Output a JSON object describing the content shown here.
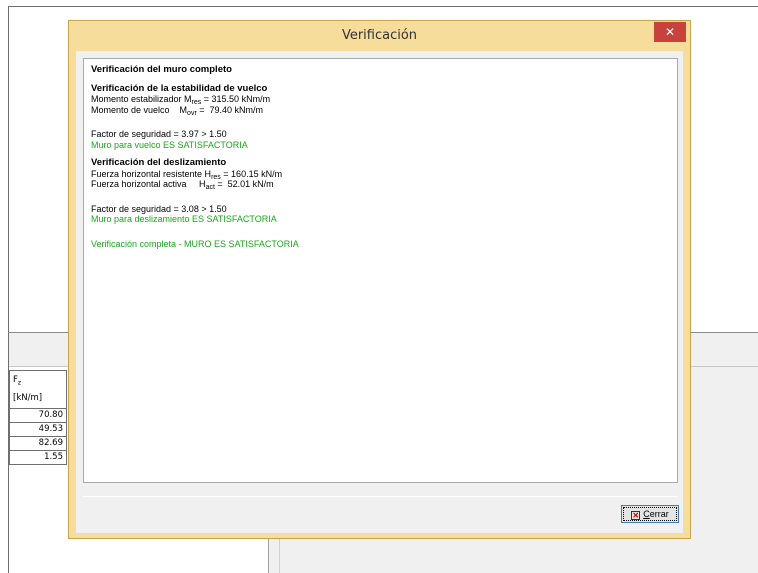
{
  "background": {
    "table": {
      "header_symbol": "F",
      "header_sub": "z",
      "header_unit": "[kN/m]",
      "rows": [
        "70.80",
        "49.53",
        "82.69",
        "1.55"
      ]
    }
  },
  "dialog": {
    "title": "Verificación",
    "close_glyph": "✕",
    "content": {
      "main_heading": "Verificación del muro completo",
      "overturning": {
        "heading": "Verificación de la estabilidad de vuelco",
        "line1_label": "Momento estabilizador M",
        "line1_sub": "res",
        "line1_value": " = 315.50 kNm/m",
        "line2_label": "Momento de vuelco    M",
        "line2_sub": "ovr",
        "line2_value": " =  79.40 kNm/m",
        "safety": "Factor de seguridad = 3.97 > 1.50",
        "result": "Muro para vuelco ES SATISFACTORIA"
      },
      "sliding": {
        "heading": "Verificación del deslizamiento",
        "line1_label": "Fuerza horizontal resistente H",
        "line1_sub": "res",
        "line1_value": " = 160.15 kN/m",
        "line2_label": "Fuerza horizontal activa     H",
        "line2_sub": "act",
        "line2_value": " =  52.01 kN/m",
        "safety": "Factor de seguridad = 3.08 > 1.50",
        "result": "Muro para deslizamiento ES SATISFACTORIA"
      },
      "final": "Verificación completa - MURO ES SATISFACTORIA"
    },
    "close_button": {
      "icon_glyph": "✕",
      "label_underlined": "C",
      "label_rest": "errar"
    }
  }
}
